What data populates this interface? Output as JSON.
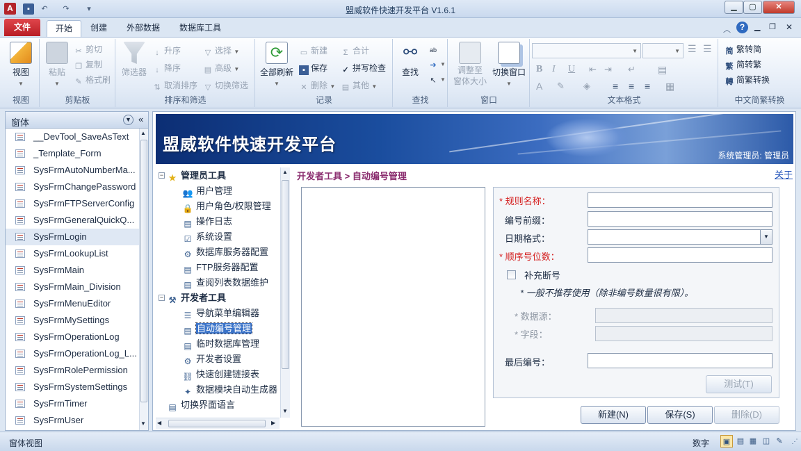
{
  "window": {
    "title": "盟威软件快速开发平台 V1.6.1",
    "app_badge": "A"
  },
  "ribbon": {
    "tabs": [
      "文件",
      "开始",
      "创建",
      "外部数据",
      "数据库工具"
    ],
    "active_tab": "开始",
    "groups": {
      "view": {
        "label": "视图",
        "view_button": "视图"
      },
      "clipboard": {
        "label": "剪贴板",
        "paste": "粘贴",
        "cut": "剪切",
        "copy": "复制",
        "format_painter": "格式刷"
      },
      "sort_filter": {
        "label": "排序和筛选",
        "filter": "筛选器",
        "ascending": "升序",
        "descending": "降序",
        "remove_sort": "取消排序",
        "select": "选择",
        "advanced": "高级",
        "toggle_filter": "切换筛选"
      },
      "records": {
        "label": "记录",
        "refresh_all": "全部刷新",
        "new": "新建",
        "save": "保存",
        "delete": "删除",
        "totals": "合计",
        "spelling": "拼写检查",
        "more": "其他"
      },
      "find": {
        "label": "查找",
        "find": "查找"
      },
      "window": {
        "label": "窗口",
        "size_to_fit": "调整至\n窗体大小",
        "switch_windows": "切换窗口"
      },
      "text_format": {
        "label": "文本格式"
      },
      "chinese_conversion": {
        "label": "中文简繁转换",
        "to_simplified": "繁转简",
        "to_traditional": "简转繁",
        "convert": "简繁转换"
      }
    }
  },
  "nav_pane": {
    "header": "窗体",
    "items": [
      "__DevTool_SaveAsText",
      "_Template_Form",
      "SysFrmAutoNumberMa...",
      "SysFrmChangePassword",
      "SysFrmFTPServerConfig",
      "SysFrmGeneralQuickQ...",
      "SysFrmLogin",
      "SysFrmLookupList",
      "SysFrmMain",
      "SysFrmMain_Division",
      "SysFrmMenuEditor",
      "SysFrmMySettings",
      "SysFrmOperationLog",
      "SysFrmOperationLog_L...",
      "SysFrmRolePermission",
      "SysFrmSystemSettings",
      "SysFrmTimer",
      "SysFrmUser"
    ],
    "selected_index": 6
  },
  "banner": {
    "title": "盟威软件快速开发平台",
    "user": "系统管理员: 管理员"
  },
  "tree": {
    "admin_group": "管理员工具",
    "admin_items": [
      "用户管理",
      "用户角色/权限管理",
      "操作日志",
      "系统设置",
      "数据库服务器配置",
      "FTP服务器配置",
      "查阅列表数据维护"
    ],
    "dev_group": "开发者工具",
    "dev_items": [
      "导航菜单编辑器",
      "自动编号管理",
      "临时数据库管理",
      "开发者设置",
      "快速创建链接表",
      "数据模块自动生成器"
    ],
    "switch_language": "切换界面语言",
    "selected": "自动编号管理"
  },
  "content": {
    "breadcrumb": "开发者工具 > 自动编号管理",
    "about_link": "关于"
  },
  "form": {
    "rule_name_label": "* 规则名称：",
    "prefix_label": "编号前缀：",
    "date_format_label": "日期格式：",
    "seq_digits_label": "* 顺序号位数：",
    "supplement_label": "补充断号",
    "supplement_checked": false,
    "supplement_note": "* 一般不推荐使用（除非编号数量很有限）。",
    "datasource_label": "* 数据源：",
    "field_label": "* 字段：",
    "last_number_label": "最后编号：",
    "test_button": "测试(T)",
    "new_button": "新建(N)",
    "save_button": "保存(S)",
    "delete_button": "删除(D)",
    "colors": {
      "required": "#d41b1b",
      "breadcrumb": "#8a2c6e"
    }
  },
  "status_bar": {
    "left": "窗体视图",
    "mode": "数字"
  }
}
